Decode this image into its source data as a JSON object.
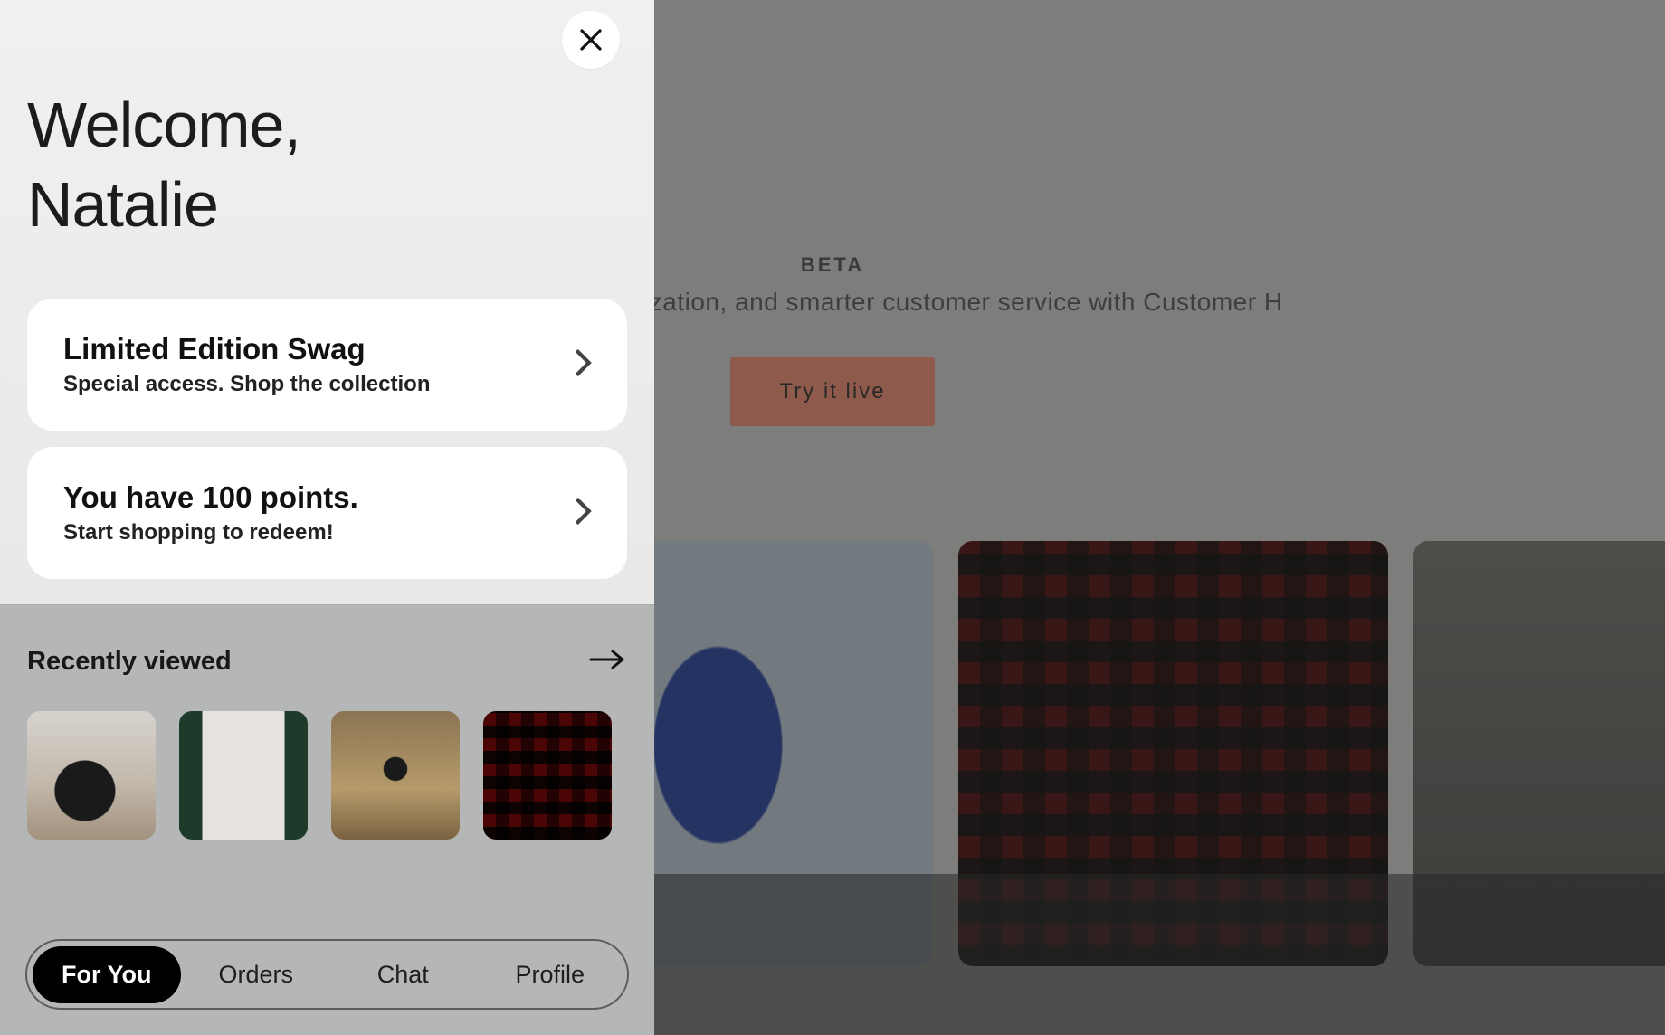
{
  "background": {
    "beta_label": "BETA",
    "tagline": "engagement, personalization, and smarter customer service with Customer H",
    "cta_label": "Try it live"
  },
  "panel": {
    "welcome_line1": "Welcome,",
    "welcome_line2": "Natalie",
    "cards": [
      {
        "title": "Limited Edition Swag",
        "subtitle": "Special access. Shop the collection"
      },
      {
        "title": "You have 100 points.",
        "subtitle": "Start shopping to redeem!"
      }
    ],
    "recent": {
      "title": "Recently viewed",
      "items": [
        {
          "name": "black leather shoulder bag"
        },
        {
          "name": "varsity letterman jacket"
        },
        {
          "name": "person with camera in field"
        },
        {
          "name": "red black buffalo plaid flannel"
        }
      ]
    },
    "tabs": [
      {
        "label": "For You",
        "active": true
      },
      {
        "label": "Orders",
        "active": false
      },
      {
        "label": "Chat",
        "active": false
      },
      {
        "label": "Profile",
        "active": false
      }
    ]
  }
}
